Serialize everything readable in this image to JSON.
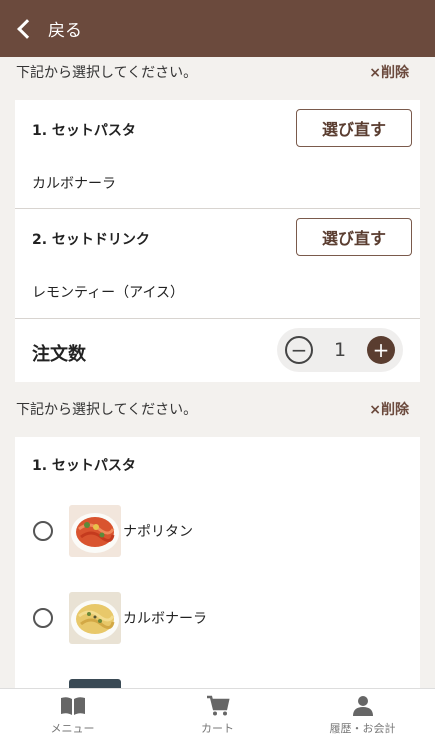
{
  "header": {
    "back_label": "戻る"
  },
  "section1": {
    "instruction": "下記から選択してください。",
    "delete_label": "×削除",
    "items": [
      {
        "title": "1. セットパスタ",
        "value": "カルボナーラ",
        "reselect_label": "選び直す"
      },
      {
        "title": "2. セットドリンク",
        "value": "レモンティー（アイス）",
        "reselect_label": "選び直す"
      }
    ],
    "quantity": {
      "label": "注文数",
      "value": "1",
      "minus": "−",
      "plus": "+"
    }
  },
  "section2": {
    "instruction": "下記から選択してください。",
    "delete_label": "×削除",
    "group_title": "1. セットパスタ",
    "options": [
      {
        "label": "ナポリタン"
      },
      {
        "label": "カルボナーラ"
      },
      {
        "label": ""
      }
    ]
  },
  "bottom_nav": {
    "items": [
      {
        "label": "メニュー",
        "icon": "book-icon"
      },
      {
        "label": "カート",
        "icon": "cart-icon"
      },
      {
        "label": "履歴・お会計",
        "icon": "user-icon"
      }
    ]
  },
  "colors": {
    "brand": "#6b4a3d",
    "background": "#f3f1ee"
  }
}
